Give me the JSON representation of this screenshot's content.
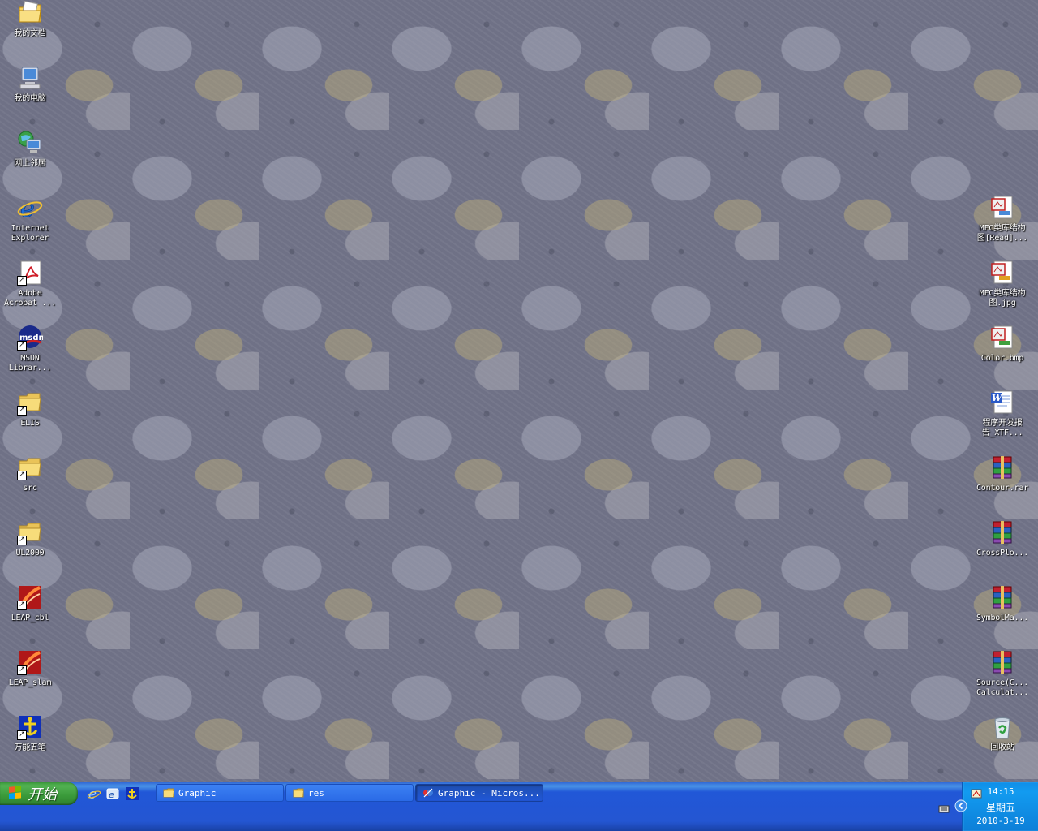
{
  "desktop": {
    "left_icons": [
      {
        "label": "我的文档",
        "icon": "my-documents-icon"
      },
      {
        "label": "我的电脑",
        "icon": "my-computer-icon"
      },
      {
        "label": "网上邻居",
        "icon": "network-places-icon"
      },
      {
        "label": "Internet\nExplorer",
        "icon": "internet-explorer-icon"
      },
      {
        "label": "Adobe\nAcrobat ...",
        "icon": "adobe-acrobat-icon"
      },
      {
        "label": "MSDN\nLibrar...",
        "icon": "msdn-library-icon"
      },
      {
        "label": "ELIS",
        "icon": "folder-icon"
      },
      {
        "label": "src",
        "icon": "folder-icon"
      },
      {
        "label": "UL2000",
        "icon": "folder-icon"
      },
      {
        "label": "LEAP_cbl",
        "icon": "leap-app-icon"
      },
      {
        "label": "LEAP_slam",
        "icon": "leap-app-icon"
      },
      {
        "label": "万能五笔",
        "icon": "wanneng-wubi-icon"
      }
    ],
    "right_icons": [
      {
        "label": "MFC类库结构\n图[Read]...",
        "icon": "image-file-icon"
      },
      {
        "label": "MFC类库结构\n图.jpg",
        "icon": "image-file-icon"
      },
      {
        "label": "Color.bmp",
        "icon": "image-file-icon"
      },
      {
        "label": "程序开发报\n告_XTF...",
        "icon": "word-document-icon"
      },
      {
        "label": "Contour.rar",
        "icon": "winrar-archive-icon"
      },
      {
        "label": "CrossPlo...",
        "icon": "winrar-archive-icon"
      },
      {
        "label": "SymbolMa...",
        "icon": "winrar-archive-icon"
      },
      {
        "label": "Source(C...\nCalculat...",
        "icon": "winrar-archive-icon"
      },
      {
        "label": "回收站",
        "icon": "recycle-bin-icon"
      }
    ]
  },
  "taskbar": {
    "start_label": "开始",
    "tasks": [
      {
        "label": "Graphic",
        "icon": "folder-icon",
        "active": false
      },
      {
        "label": "res",
        "icon": "folder-icon",
        "active": false
      },
      {
        "label": "Graphic - Micros...",
        "icon": "visual-studio-icon",
        "active": true
      }
    ],
    "tray": {
      "time": "14:15",
      "weekday": "星期五",
      "date": "2010-3-19"
    }
  }
}
